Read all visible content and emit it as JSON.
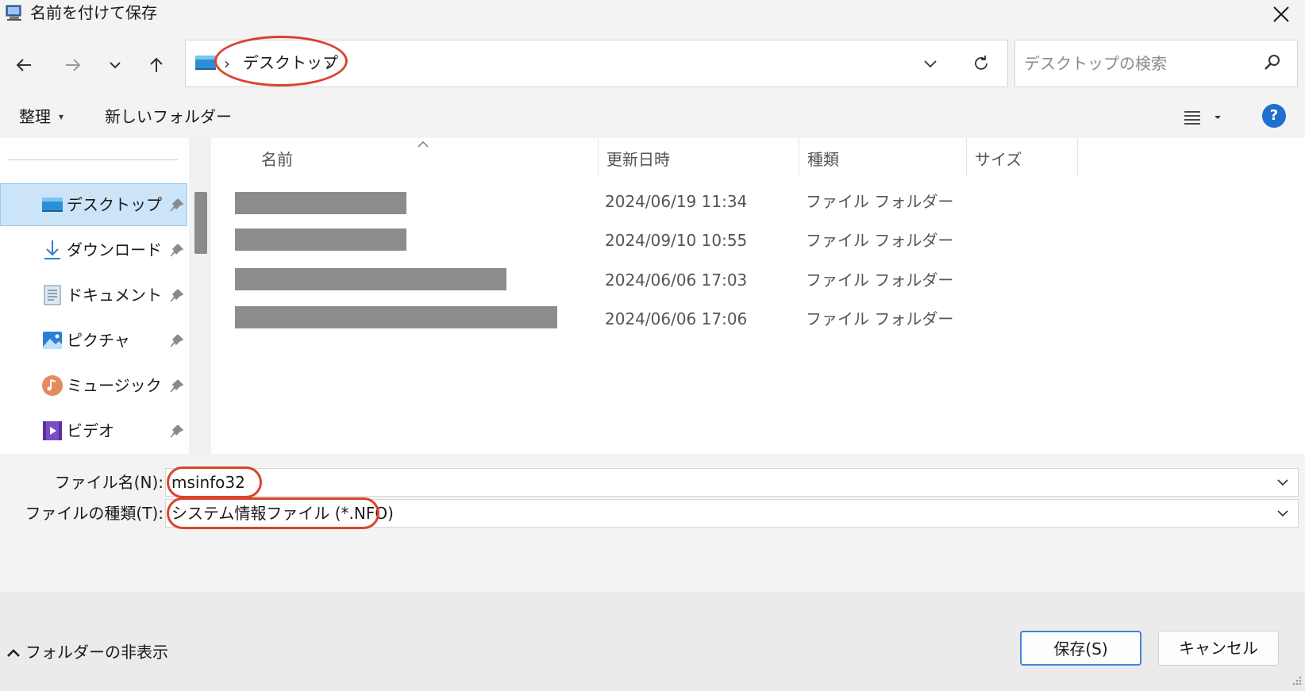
{
  "window": {
    "title": "名前を付けて保存",
    "close_label": "×"
  },
  "address": {
    "separator": "›",
    "current": "デスクトップ",
    "search_placeholder": "デスクトップの検索"
  },
  "toolbar": {
    "organize_label": "整理",
    "organize_caret": "▾",
    "new_folder_label": "新しいフォルダー",
    "help_label": "?"
  },
  "sidebar": {
    "items": [
      {
        "label": "デスクトップ",
        "icon": "desktop-icon",
        "selected": true
      },
      {
        "label": "ダウンロード",
        "icon": "download-icon",
        "selected": false
      },
      {
        "label": "ドキュメント",
        "icon": "document-icon",
        "selected": false
      },
      {
        "label": "ピクチャ",
        "icon": "pictures-icon",
        "selected": false
      },
      {
        "label": "ミュージック",
        "icon": "music-icon",
        "selected": false
      },
      {
        "label": "ビデオ",
        "icon": "video-icon",
        "selected": false
      }
    ]
  },
  "columns": {
    "name": "名前",
    "modified": "更新日時",
    "type": "種類",
    "size": "サイズ"
  },
  "files": [
    {
      "name_redacted": true,
      "modified": "2024/06/19 11:34",
      "type": "ファイル フォルダー"
    },
    {
      "name_redacted": true,
      "modified": "2024/09/10 10:55",
      "type": "ファイル フォルダー"
    },
    {
      "name_redacted": true,
      "modified": "2024/06/06 17:03",
      "type": "ファイル フォルダー"
    },
    {
      "name_redacted": true,
      "modified": "2024/06/06 17:06",
      "type": "ファイル フォルダー"
    }
  ],
  "form": {
    "filename_label": "ファイル名(N):",
    "filename_value": "msinfo32",
    "filetype_label": "ファイルの種類(T):",
    "filetype_value": "システム情報ファイル (*.NFO)"
  },
  "footer": {
    "hide_folders_label": "フォルダーの非表示",
    "save_label": "保存(S)",
    "cancel_label": "キャンセル"
  },
  "colors": {
    "accent": "#1f6fd1",
    "annotation": "#d9442b",
    "selection": "#cce4f7"
  }
}
